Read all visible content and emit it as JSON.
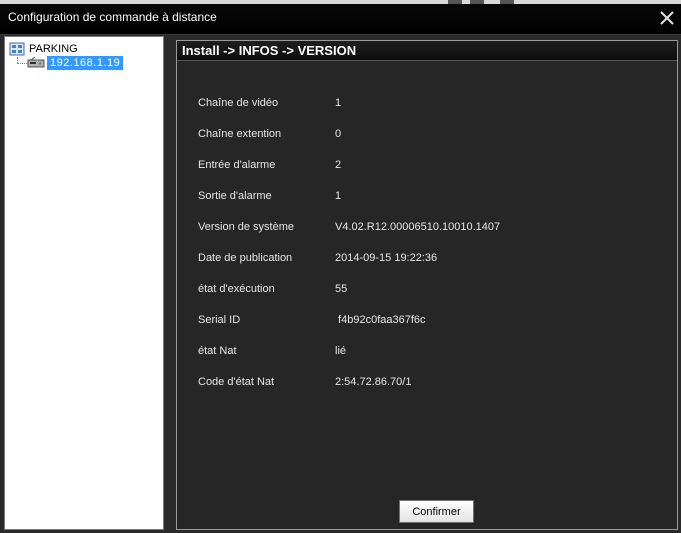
{
  "window": {
    "title": "Configuration de commande à distance"
  },
  "tree": {
    "root_label": "PARKING",
    "child_label": "192.168.1.19"
  },
  "main": {
    "breadcrumb": "Install -> INFOS -> VERSION",
    "rows": [
      {
        "label": "Chaîne de vidéo",
        "value": "1"
      },
      {
        "label": "Chaîne extention",
        "value": "0"
      },
      {
        "label": "Entrée d'alarme",
        "value": "2"
      },
      {
        "label": "Sortie d'alarme",
        "value": "1"
      },
      {
        "label": "Version de système",
        "value": "V4.02.R12.00006510.10010.1407"
      },
      {
        "label": "Date de publication",
        "value": "2014-09-15 19:22:36"
      },
      {
        "label": "état d'exécution",
        "value": "55"
      },
      {
        "label": "Serial ID",
        "value": " f4b92c0faa367f6c"
      },
      {
        "label": "état Nat",
        "value": "lié"
      },
      {
        "label": "Code d'état Nat",
        "value": "2:54.72.86.70/1"
      }
    ],
    "confirm_label": "Confirmer"
  },
  "icons": {
    "close": "close-icon",
    "root": "network-group-icon",
    "device": "dvr-device-icon"
  },
  "colors": {
    "selection": "#3399ff",
    "panel_bg": "#262626",
    "titlebar_bg": "#000000"
  }
}
